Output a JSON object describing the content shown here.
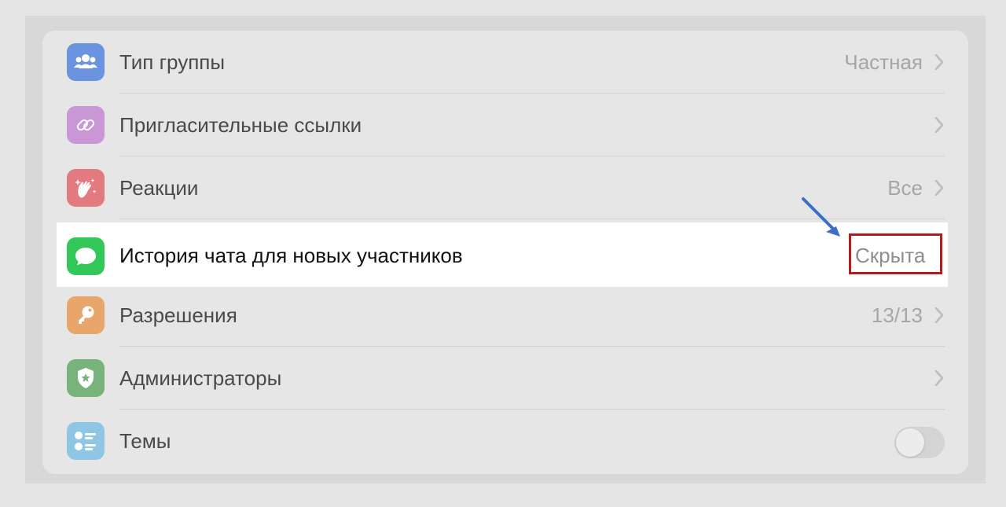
{
  "settings": {
    "rows": [
      {
        "label": "Тип группы",
        "value": "Частная",
        "icon": "group-icon",
        "icon_color": "#6a94e0"
      },
      {
        "label": "Пригласительные ссылки",
        "value": "",
        "icon": "link-icon",
        "icon_color": "#c996d6"
      },
      {
        "label": "Реакции",
        "value": "Все",
        "icon": "clapping-hands-icon",
        "icon_color": "#e37a80"
      },
      {
        "label": "История чата для новых участников",
        "value": "Скрыта",
        "icon": "chat-bubble-icon",
        "icon_color": "#33c759"
      },
      {
        "label": "Разрешения",
        "value": "13/13",
        "icon": "key-icon",
        "icon_color": "#e8a66a"
      },
      {
        "label": "Администраторы",
        "value": "",
        "icon": "shield-star-icon",
        "icon_color": "#78b37b"
      },
      {
        "label": "Темы",
        "value": "",
        "icon": "topics-list-icon",
        "icon_color": "#8fc6e4",
        "toggle_on": false
      }
    ]
  },
  "annotation": {
    "highlight_color": "#b71c1c",
    "arrow_color": "#3f6fc7"
  }
}
